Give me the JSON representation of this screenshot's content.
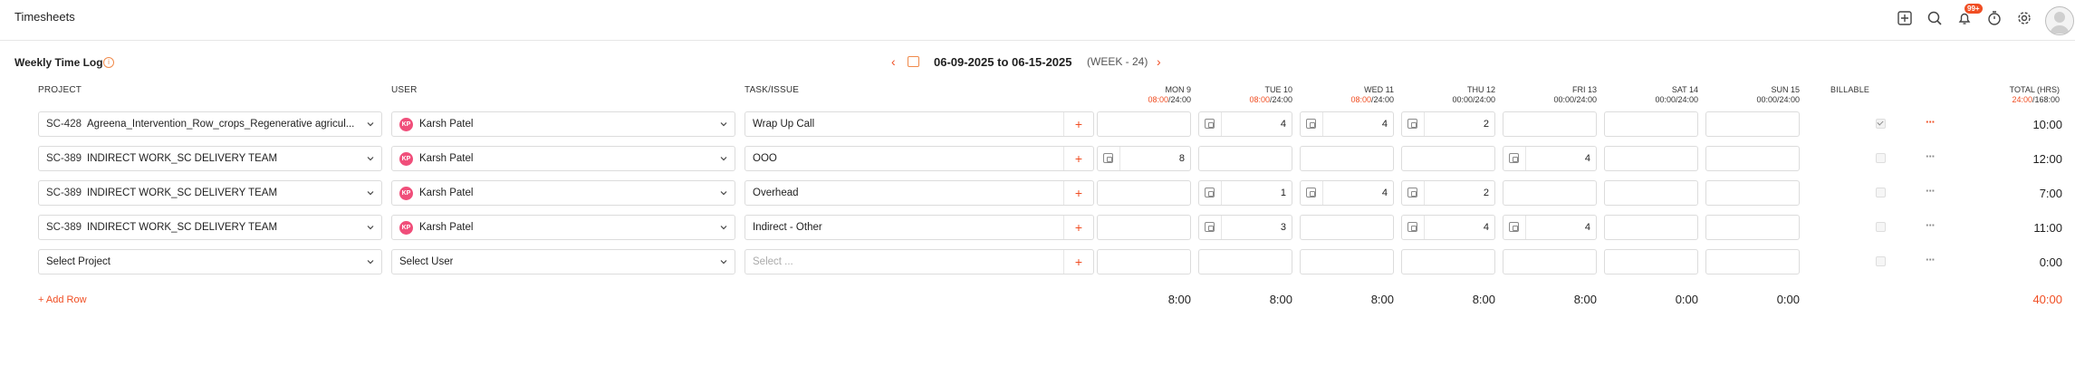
{
  "app": {
    "title": "Timesheets",
    "notif_count": "99+"
  },
  "icons": [
    "plus-square-icon",
    "search-icon",
    "bell-icon",
    "timer-icon",
    "gear-icon",
    "avatar"
  ],
  "header": {
    "log_title": "Weekly Time Log",
    "date_range": "06-09-2025 to 06-15-2025",
    "week": "(WEEK - 24)"
  },
  "columns": {
    "project": "PROJECT",
    "user": "USER",
    "task": "TASK/ISSUE",
    "billable": "BILLABLE",
    "total": "TOTAL (HRS)",
    "total_logged": "24:00",
    "total_cap": "/168:00",
    "days": [
      {
        "label": "MON 9",
        "logged": "08:00",
        "cap": "/24:00",
        "hl": true
      },
      {
        "label": "TUE 10",
        "logged": "08:00",
        "cap": "/24:00",
        "hl": true
      },
      {
        "label": "WED 11",
        "logged": "08:00",
        "cap": "/24:00",
        "hl": true
      },
      {
        "label": "THU 12",
        "logged": "00:00",
        "cap": "/24:00",
        "hl": false
      },
      {
        "label": "FRI 13",
        "logged": "00:00",
        "cap": "/24:00",
        "hl": false
      },
      {
        "label": "SAT 14",
        "logged": "00:00",
        "cap": "/24:00",
        "hl": false
      },
      {
        "label": "SUN 15",
        "logged": "00:00",
        "cap": "/24:00",
        "hl": false
      }
    ]
  },
  "rows": [
    {
      "code": "SC-428",
      "project": "Agreena_Intervention_Row_crops_Regenerative agricul...",
      "user": "Karsh Patel",
      "initials": "KP",
      "task": "Wrap Up Call",
      "hours": [
        "",
        "4",
        "4",
        "2",
        "",
        "",
        ""
      ],
      "billable": true,
      "total": "10:00"
    },
    {
      "code": "SC-389",
      "project": "INDIRECT WORK_SC DELIVERY TEAM",
      "user": "Karsh Patel",
      "initials": "KP",
      "task": "OOO",
      "hours": [
        "8",
        "",
        "",
        "",
        "4",
        "",
        ""
      ],
      "billable": false,
      "total": "12:00"
    },
    {
      "code": "SC-389",
      "project": "INDIRECT WORK_SC DELIVERY TEAM",
      "user": "Karsh Patel",
      "initials": "KP",
      "task": "Overhead",
      "hours": [
        "",
        "1",
        "4",
        "2",
        "",
        "",
        ""
      ],
      "billable": false,
      "total": "7:00"
    },
    {
      "code": "SC-389",
      "project": "INDIRECT WORK_SC DELIVERY TEAM",
      "user": "Karsh Patel",
      "initials": "KP",
      "task": "Indirect - Other",
      "hours": [
        "",
        "3",
        "",
        "4",
        "4",
        "",
        ""
      ],
      "billable": false,
      "total": "11:00"
    }
  ],
  "new_row": {
    "project": "Select Project",
    "user": "Select User",
    "task_placeholder": "Select ...",
    "total": "0:00"
  },
  "footer": {
    "add_row": "+ Add Row",
    "sums": [
      "8:00",
      "8:00",
      "8:00",
      "8:00",
      "8:00",
      "0:00",
      "0:00"
    ],
    "grand_total": "40:00"
  }
}
